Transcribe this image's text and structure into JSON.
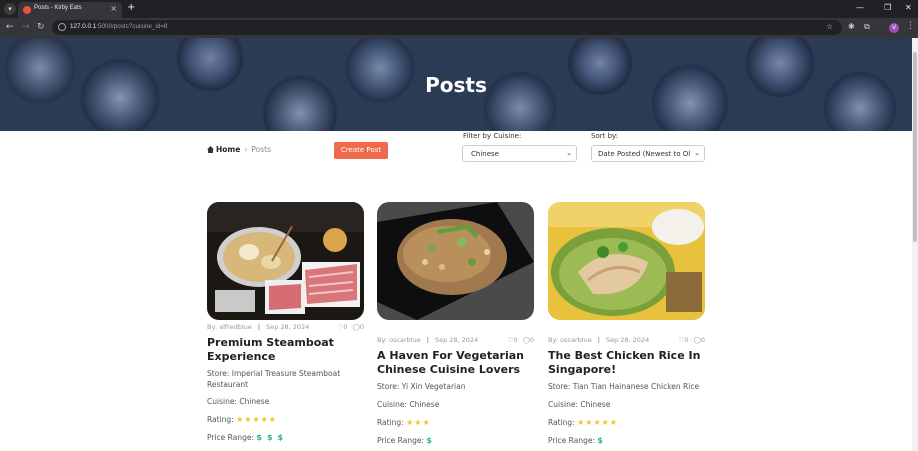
{
  "browser": {
    "tab_title": "Posts - Kirby Eats",
    "url_host": "127.0.0.1",
    "url_rest": ":5000/posts?cuisine_id=8",
    "avatar_letter": "V"
  },
  "hero": {
    "title": "Posts"
  },
  "breadcrumb": {
    "home": "Home",
    "separator": "›",
    "current": "Posts"
  },
  "create_button": "Create Post",
  "filter": {
    "label": "Filter by Cuisine:",
    "selected": "Chinese"
  },
  "sort": {
    "label": "Sort by:",
    "selected": "Date Posted (Newest to Ol"
  },
  "posts": [
    {
      "author": "By: alfredblue",
      "date": "Sep 28, 2024",
      "likes": "0",
      "comments": "0",
      "title": "Premium Steamboat Experience",
      "store": "Store: Imperial Treasure Steamboat Restaurant",
      "cuisine": "Cuisine: Chinese",
      "rating_label": "Rating:",
      "rating": 5,
      "price_label": "Price Range:",
      "price_level": 3
    },
    {
      "author": "By: oscarblue",
      "date": "Sep 28, 2024",
      "likes": "0",
      "comments": "0",
      "title": "A Haven For Vegetarian Chinese Cuisine Lovers",
      "store": "Store: Yi Xin Vegetarian",
      "cuisine": "Cuisine: Chinese",
      "rating_label": "Rating:",
      "rating": 3,
      "price_label": "Price Range:",
      "price_level": 1
    },
    {
      "author": "By: oscarblue",
      "date": "Sep 28, 2024",
      "likes": "0",
      "comments": "0",
      "title": "The Best Chicken Rice In Singapore!",
      "store": "Store: Tian Tian Hainanese Chicken Rice",
      "cuisine": "Cuisine: Chinese",
      "rating_label": "Rating:",
      "rating": 5,
      "price_label": "Price Range:",
      "price_level": 1
    }
  ],
  "colors": {
    "accent": "#ef6a4c",
    "star": "#f5c518",
    "price": "#2bb673"
  }
}
